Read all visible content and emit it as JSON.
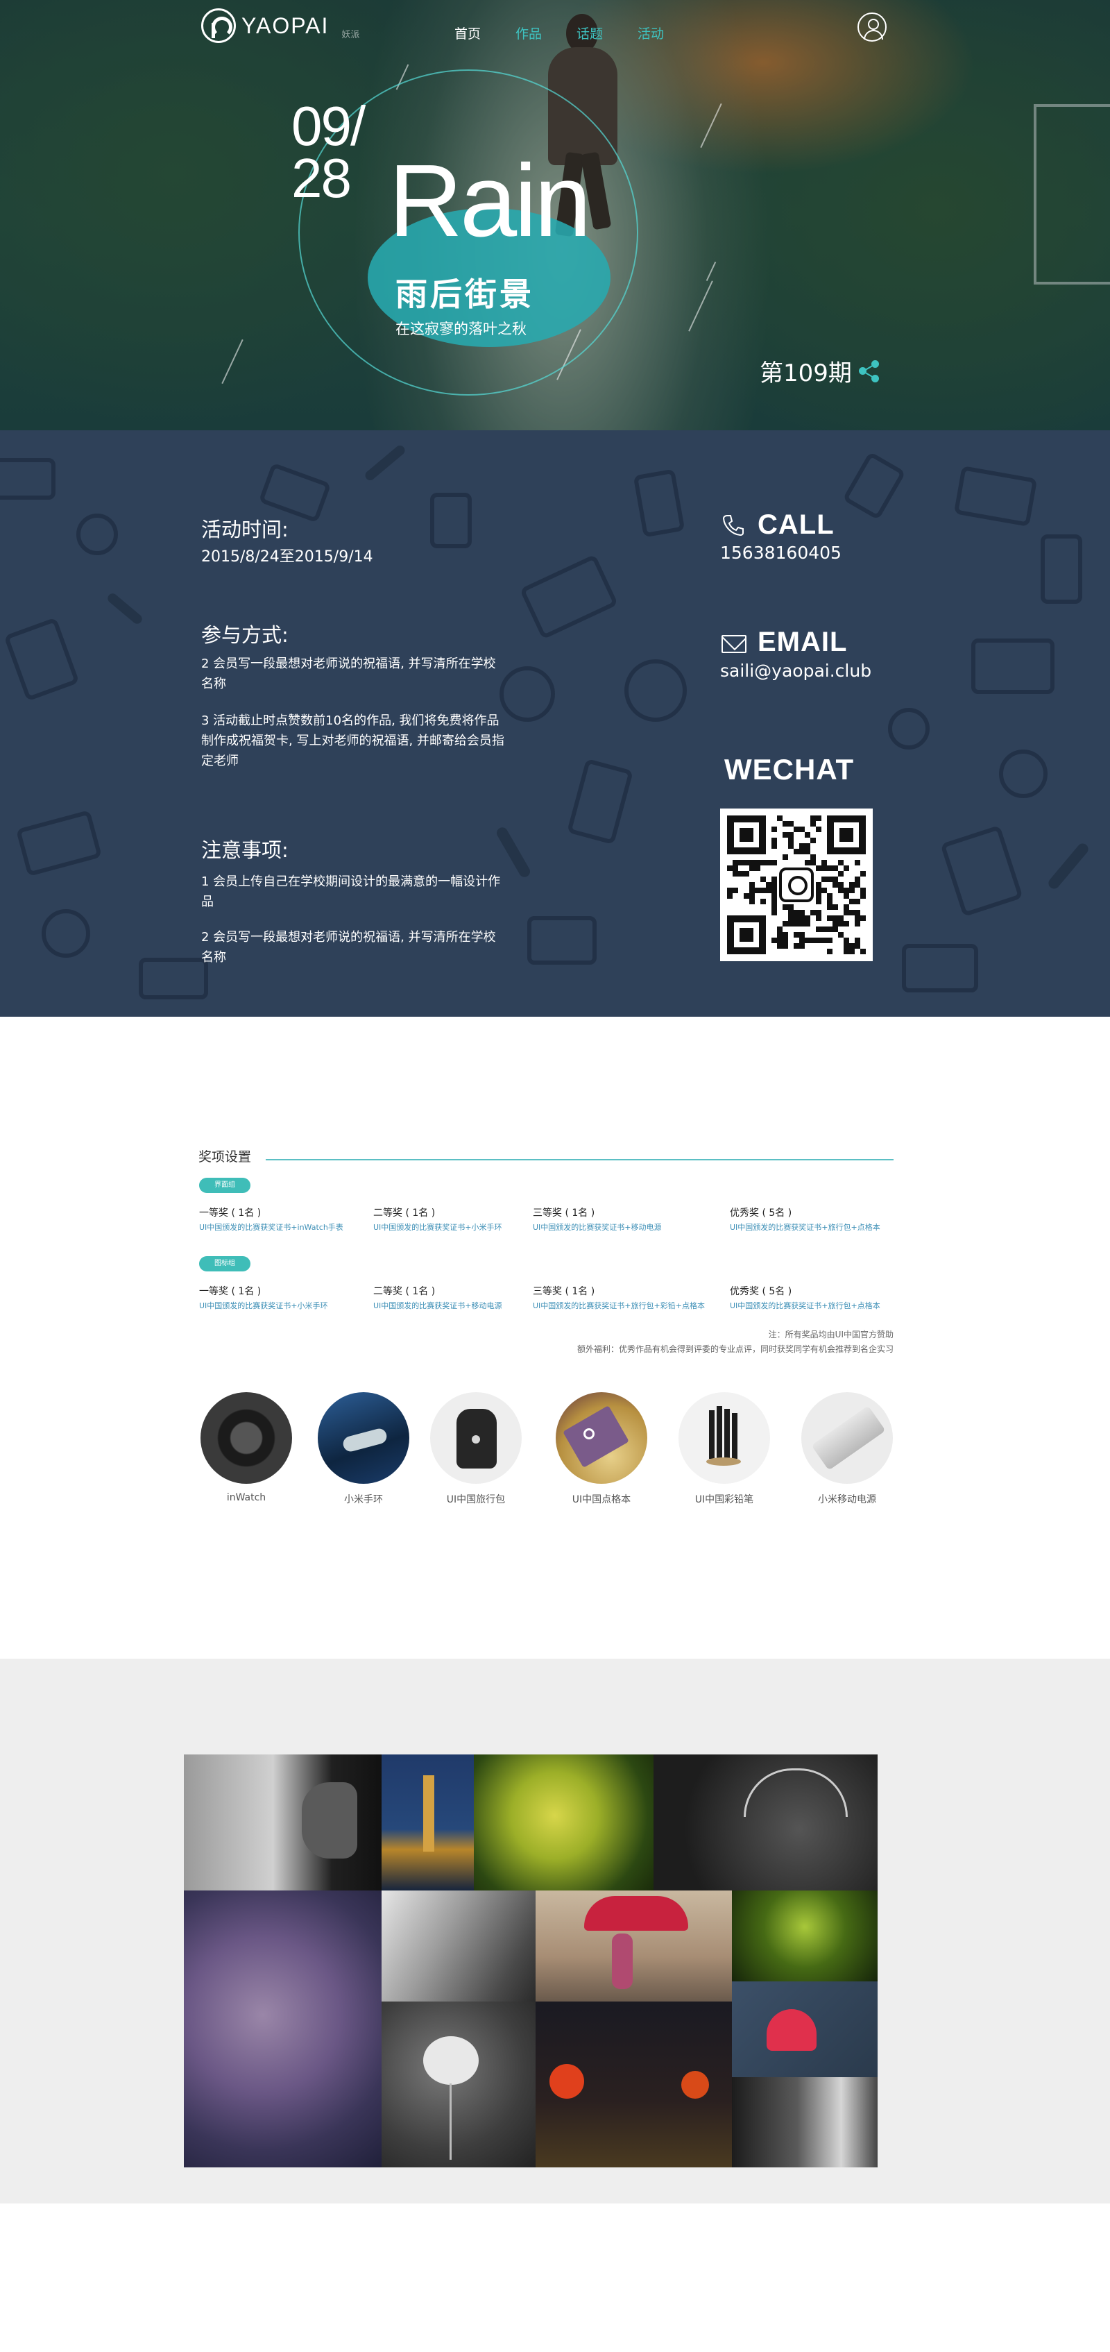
{
  "nav": {
    "logo_text": "YAOPAI",
    "logo_sub": "妖派",
    "links": [
      "首页",
      "作品",
      "话题",
      "活动"
    ],
    "active_links": [
      1,
      3
    ]
  },
  "hero": {
    "month": "09/",
    "day": "28",
    "title_en": "Rain",
    "title_cn": "雨后街景",
    "subtitle": "在这寂寥的落叶之秋",
    "issue": "第109期"
  },
  "info": {
    "time_title": "活动时间:",
    "time_value": "2015/8/24至2015/9/14",
    "method_title": "参与方式:",
    "method_items": [
      "2 会员写一段最想对老师说的祝福语, 并写清所在学校名称",
      "3   活动截止时点赞数前10名的作品, 我们将免费将作品制作成祝福贺卡, 写上对老师的祝福语, 并邮寄给会员指定老师"
    ],
    "notes_title": "注意事项:",
    "notes_items": [
      "1   会员上传自己在学校期间设计的最满意的一幅设计作品",
      "2 会员写一段最想对老师说的祝福语, 并写清所在学校名称"
    ],
    "call_title": "CALL",
    "call_value": "15638160405",
    "email_title": "EMAIL",
    "email_value": "saili@yaopai.club",
    "wechat_title": "WECHAT"
  },
  "awards": {
    "title": "奖项设置",
    "groups": [
      {
        "tag": "界面组",
        "prizes": [
          {
            "name": "一等奖 ( 1名 )",
            "desc": "UI中国颁发的比赛获奖证书+inWatch手表"
          },
          {
            "name": "二等奖 ( 1名 )",
            "desc": "UI中国颁发的比赛获奖证书+小米手环"
          },
          {
            "name": "三等奖 ( 1名 )",
            "desc": "UI中国颁发的比赛获奖证书+移动电源"
          },
          {
            "name": "优秀奖 ( 5名 )",
            "desc": "UI中国颁发的比赛获奖证书+旅行包+点格本"
          }
        ]
      },
      {
        "tag": "图标组",
        "prizes": [
          {
            "name": "一等奖 ( 1名 )",
            "desc": "UI中国颁发的比赛获奖证书+小米手环"
          },
          {
            "name": "二等奖 ( 1名 )",
            "desc": "UI中国颁发的比赛获奖证书+移动电源"
          },
          {
            "name": "三等奖 ( 1名 )",
            "desc": "UI中国颁发的比赛获奖证书+旅行包+彩铅+点格本"
          },
          {
            "name": "优秀奖 ( 5名 )",
            "desc": "UI中国颁发的比赛获奖证书+旅行包+点格本"
          }
        ]
      }
    ],
    "note1": "注：所有奖品均由UI中国官方赞助",
    "note2": "额外福利：优秀作品有机会得到评委的专业点评，同时获奖同学有机会推荐到名企实习",
    "items": [
      "inWatch",
      "小米手环",
      "UI中国旅行包",
      "UI中国点格本",
      "UI中国彩铅笔",
      "小米移动电源"
    ]
  },
  "colors": {
    "accent": "#3ec3c1",
    "info_bg": "#2f4159",
    "pill": "#3fbdb8",
    "prize_desc": "#3d8fb6"
  }
}
